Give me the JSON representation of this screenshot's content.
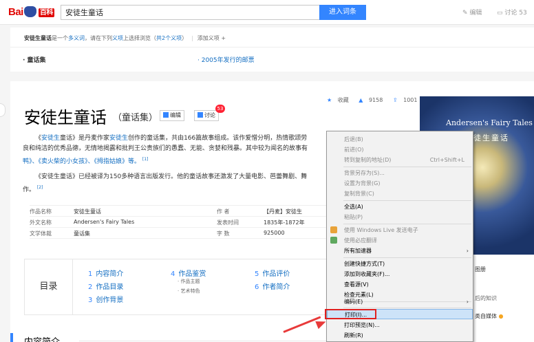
{
  "header": {
    "logo_text": "Bai",
    "logo_text2": "百科",
    "search_value": "安徒生童话",
    "search_button": "进入词条",
    "edit": "编辑",
    "discuss": "讨论 53"
  },
  "polysemy": {
    "term": "安徒生童话",
    "desc_1": "是一个",
    "desc_link": "多义词",
    "desc_2": "，请在下列",
    "desc_link2": "义项",
    "desc_3": "上选择浏览（",
    "count": "共2个义项",
    "desc_4": "）",
    "add": "添加义项 +",
    "item_left": "· 童话集",
    "item_right": "· 2005年发行的邮票"
  },
  "stats": {
    "favorite": "收藏",
    "likes": "9158",
    "shares": "1001"
  },
  "title": {
    "main": "安徒生童话",
    "sub": "（童话集）",
    "edit_btn": "编辑",
    "discuss_btn": "讨论",
    "badge": "53"
  },
  "para1": {
    "t1": "《",
    "link1": "安徒生",
    "t2": "童话》是丹麦作家",
    "link2": "安徒生",
    "t3": "创作的童话集，共由166篇故事组成。该作爱憎分明，热情歌颂劳",
    "line2": "良和纯洁的优秀品德，无情地揭露和批判王公贵族们的愚蠢、无能、贪婪和残暴。其中较为闻名的故事有",
    "line3": "鸭》、《卖火柴的小女孩》、《拇指姑娘》等。",
    "ref": "[1]"
  },
  "para2": {
    "line1": "《安徒生童话》已经被译为150多种语言出版发行。他的童话故事还激发了大量电影、芭蕾舞剧、舞",
    "line2": "作。",
    "ref": "[2]"
  },
  "info": [
    {
      "k1": "作品名称",
      "v1": "安徒生童话",
      "k2": "作    者",
      "v2": "【丹麦】安徒生"
    },
    {
      "k1": "外文名称",
      "v1": "Andersen's Fairy Tales",
      "k2": "发表时间",
      "v2": "1835年-1872年"
    },
    {
      "k1": "文学体裁",
      "v1": "童话集",
      "k2": "字    数",
      "v2": "925000"
    }
  ],
  "toc": {
    "label": "目录",
    "items": [
      {
        "num": "1",
        "text": "内容简介"
      },
      {
        "num": "2",
        "text": "作品目录"
      },
      {
        "num": "3",
        "text": "创作背景"
      },
      {
        "num": "4",
        "text": "作品鉴赏"
      },
      {
        "num": "5",
        "text": "作品评价"
      },
      {
        "num": "6",
        "text": "作者简介"
      }
    ],
    "subs": [
      "· 作品主题",
      "· 艺术特色"
    ]
  },
  "section": {
    "title": "内容简介"
  },
  "book": {
    "title_en": "Andersen's Fairy Tales",
    "title_cn": "徒生童话"
  },
  "right_side": {
    "album": "图册",
    "knowledge": "后的知识",
    "media": "类自媒体"
  },
  "context_menu": {
    "items": [
      {
        "label": "后退(B)",
        "disabled": true
      },
      {
        "label": "前进(O)",
        "disabled": true
      },
      {
        "label": "转到复制的地址(D)",
        "shortcut": "Ctrl+Shift+L",
        "disabled": true
      },
      {
        "label": "背景另存为(S)...",
        "disabled": true
      },
      {
        "label": "设置为背景(G)",
        "disabled": true
      },
      {
        "label": "复制背景(C)",
        "disabled": true
      },
      {
        "label": "全选(A)"
      },
      {
        "label": "粘贴(P)",
        "disabled": true
      },
      {
        "label": "使用 Windows Live 发送电子",
        "disabled": true
      },
      {
        "label": "使用必应翻译",
        "disabled": true
      },
      {
        "label": "所有加速器"
      },
      {
        "label": "创建快捷方式(T)"
      },
      {
        "label": "添加到收藏夹(F)..."
      },
      {
        "label": "查看源(V)"
      },
      {
        "label": "检查元素(L)"
      },
      {
        "label": "编码(E)"
      },
      {
        "label": "打印(I)..."
      },
      {
        "label": "打印预览(N)..."
      },
      {
        "label": "刷新(R)"
      }
    ]
  },
  "colors": {
    "accent": "#3385ff",
    "link": "#136ec2",
    "highlight": "#e02020"
  }
}
